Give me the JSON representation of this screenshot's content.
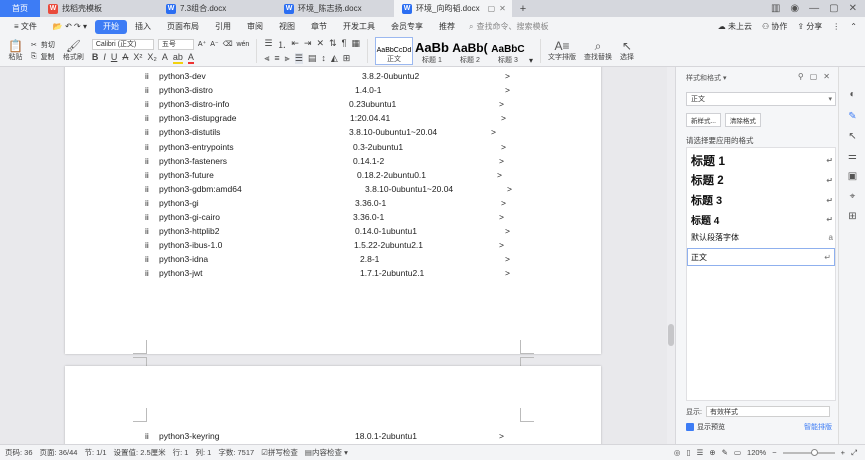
{
  "tabs": {
    "home": "首页",
    "t1": "找稻壳模板",
    "t2": "7.3组合.docx",
    "t3": "环境_陈志扬.docx",
    "t4": "环境_向昀韬.docx",
    "plus": "+"
  },
  "menu": {
    "file": "文件",
    "start": "开始",
    "insert": "插入",
    "layout": "页面布局",
    "ref": "引用",
    "review": "审阅",
    "view": "视图",
    "chapter": "章节",
    "devtools": "开发工具",
    "member": "会员专享",
    "recommend": "推荐",
    "search_placeholder": "查找命令、搜索模板",
    "cloud": "未上云",
    "collab": "协作",
    "share": "分享"
  },
  "ribbon": {
    "paste": "粘贴",
    "cut": "剪切",
    "copy": "复制",
    "format_painter": "格式刷",
    "font_name": "Calibri (正文)",
    "font_size": "五号",
    "style_normal_sample": "AaBbCcDd",
    "style_normal": "正文",
    "style_h1_sample": "AaBb",
    "style_h1": "标题 1",
    "style_h2_sample": "AaBb(",
    "style_h2": "标题 2",
    "style_h3_sample": "AaBbC",
    "style_h3": "标题 3",
    "text_layout": "文字排版",
    "find_replace": "查找替换",
    "select": "选择"
  },
  "document": {
    "bullet": "ii",
    "rows": [
      {
        "name": "python3-dev",
        "version": "3.8.2-0ubuntu2"
      },
      {
        "name": "python3-distro",
        "version": "1.4.0-1"
      },
      {
        "name": "python3-distro-info",
        "version": "0.23ubuntu1"
      },
      {
        "name": "python3-distupgrade",
        "version": "1:20.04.41"
      },
      {
        "name": "python3-distutils",
        "version": "3.8.10-0ubuntu1~20.04"
      },
      {
        "name": "python3-entrypoints",
        "version": "0.3-2ubuntu1"
      },
      {
        "name": "python3-fasteners",
        "version": "0.14.1-2"
      },
      {
        "name": "python3-future",
        "version": "0.18.2-2ubuntu0.1"
      },
      {
        "name": "python3-gdbm:amd64",
        "version": "3.8.10-0ubuntu1~20.04"
      },
      {
        "name": "python3-gi",
        "version": "3.36.0-1"
      },
      {
        "name": "python3-gi-cairo",
        "version": "3.36.0-1"
      },
      {
        "name": "python3-httplib2",
        "version": "0.14.0-1ubuntu1"
      },
      {
        "name": "python3-ibus-1.0",
        "version": "1.5.22-2ubuntu2.1"
      },
      {
        "name": "python3-idna",
        "version": "2.8-1"
      },
      {
        "name": "python3-jwt",
        "version": "1.7.1-2ubuntu2.1"
      }
    ],
    "page2_row": {
      "name": "python3-keyring",
      "version": "18.0.1-2ubuntu1"
    },
    "arrow": ">"
  },
  "panel": {
    "title": "样式和格式",
    "current_style": "正文",
    "new_style": "新样式...",
    "clear_format": "清除格式",
    "choose_label": "请选择要应用的格式",
    "styles": [
      {
        "label": "标题  1"
      },
      {
        "label": "标题  2"
      },
      {
        "label": "标题  3"
      },
      {
        "label": "标题  4"
      },
      {
        "label": "默认段落字体",
        "mark": "a"
      },
      {
        "label": "正文"
      }
    ],
    "return_mark": "↵",
    "show_label": "显示:",
    "show_value": "有效样式",
    "show_preview": "显示预览",
    "smart_layout": "智能排版"
  },
  "status": {
    "pages": "页码: 36",
    "page": "页面: 36/44",
    "section": "节: 1/1",
    "setting": "设置值: 2.5厘米",
    "line": "行: 1",
    "col": "列: 1",
    "words": "字数: 7517",
    "spell": "拼写检查",
    "content_check": "内容检查",
    "zoom": "120%"
  }
}
